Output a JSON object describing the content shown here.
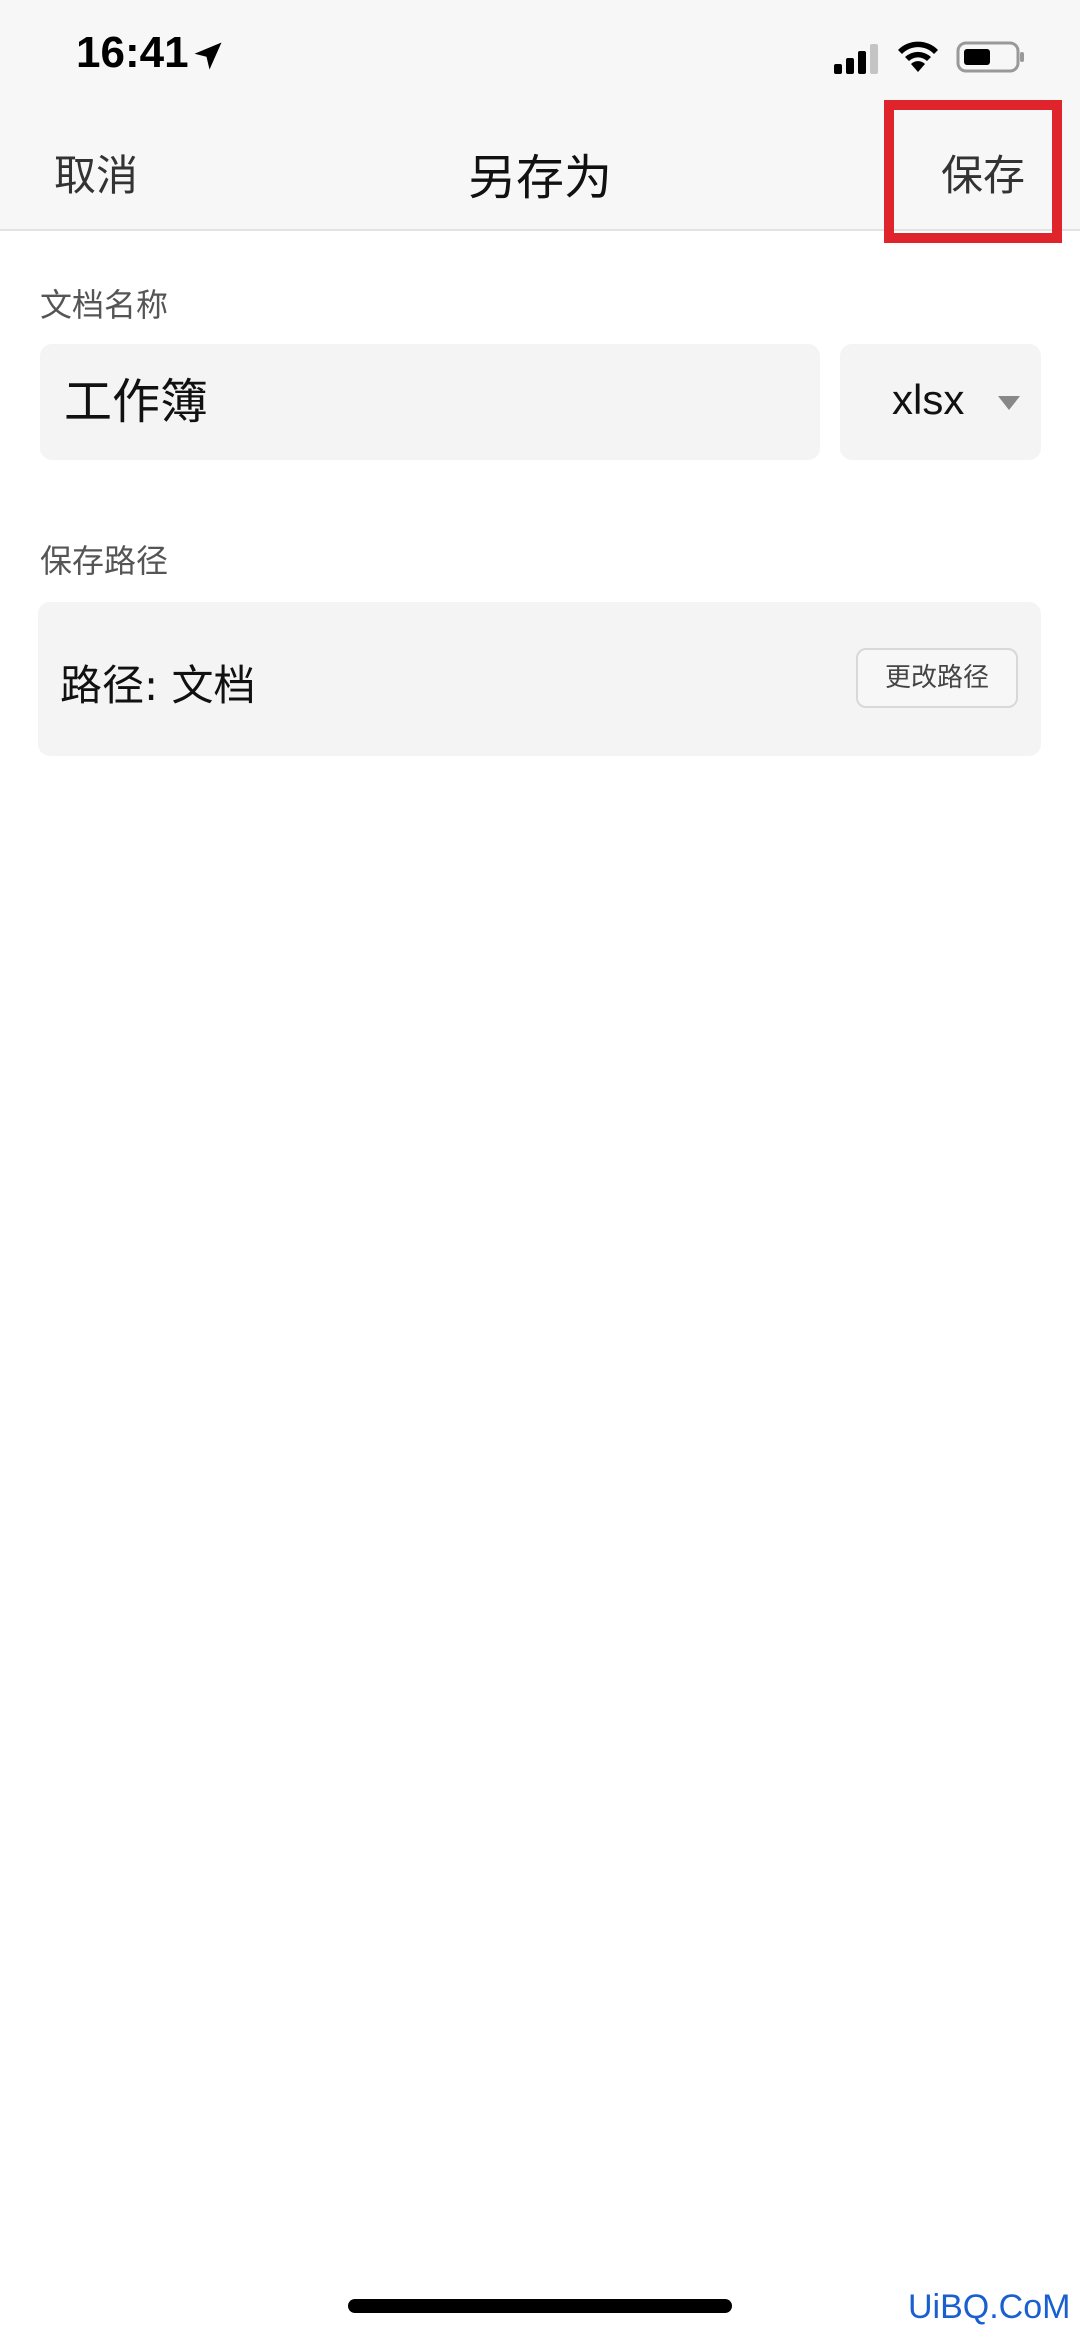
{
  "status_bar": {
    "time": "16:41",
    "icons": [
      "location-arrow-icon",
      "cellular-signal-icon",
      "wifi-icon",
      "battery-icon"
    ]
  },
  "nav": {
    "cancel_label": "取消",
    "title": "另存为",
    "save_label": "保存"
  },
  "document_name": {
    "section_label": "文档名称",
    "value": "工作簿",
    "extension": "xlsx"
  },
  "save_path": {
    "section_label": "保存路径",
    "path_text": "路径: 文档",
    "change_button_label": "更改路径"
  },
  "watermark": "UiBQ.CoM",
  "colors": {
    "highlight": "#e0242b",
    "watermark": "#1a5fd0"
  }
}
